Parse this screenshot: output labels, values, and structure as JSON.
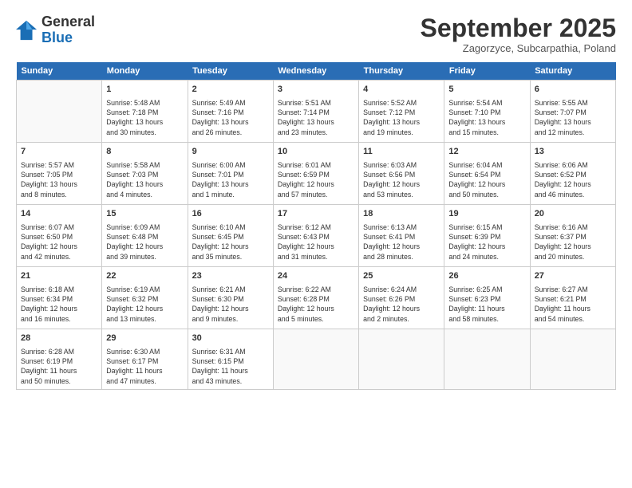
{
  "header": {
    "logo_line1": "General",
    "logo_line2": "Blue",
    "month": "September 2025",
    "location": "Zagorzyce, Subcarpathia, Poland"
  },
  "days_of_week": [
    "Sunday",
    "Monday",
    "Tuesday",
    "Wednesday",
    "Thursday",
    "Friday",
    "Saturday"
  ],
  "weeks": [
    [
      {
        "day": "",
        "text": ""
      },
      {
        "day": "1",
        "text": "Sunrise: 5:48 AM\nSunset: 7:18 PM\nDaylight: 13 hours\nand 30 minutes."
      },
      {
        "day": "2",
        "text": "Sunrise: 5:49 AM\nSunset: 7:16 PM\nDaylight: 13 hours\nand 26 minutes."
      },
      {
        "day": "3",
        "text": "Sunrise: 5:51 AM\nSunset: 7:14 PM\nDaylight: 13 hours\nand 23 minutes."
      },
      {
        "day": "4",
        "text": "Sunrise: 5:52 AM\nSunset: 7:12 PM\nDaylight: 13 hours\nand 19 minutes."
      },
      {
        "day": "5",
        "text": "Sunrise: 5:54 AM\nSunset: 7:10 PM\nDaylight: 13 hours\nand 15 minutes."
      },
      {
        "day": "6",
        "text": "Sunrise: 5:55 AM\nSunset: 7:07 PM\nDaylight: 13 hours\nand 12 minutes."
      }
    ],
    [
      {
        "day": "7",
        "text": "Sunrise: 5:57 AM\nSunset: 7:05 PM\nDaylight: 13 hours\nand 8 minutes."
      },
      {
        "day": "8",
        "text": "Sunrise: 5:58 AM\nSunset: 7:03 PM\nDaylight: 13 hours\nand 4 minutes."
      },
      {
        "day": "9",
        "text": "Sunrise: 6:00 AM\nSunset: 7:01 PM\nDaylight: 13 hours\nand 1 minute."
      },
      {
        "day": "10",
        "text": "Sunrise: 6:01 AM\nSunset: 6:59 PM\nDaylight: 12 hours\nand 57 minutes."
      },
      {
        "day": "11",
        "text": "Sunrise: 6:03 AM\nSunset: 6:56 PM\nDaylight: 12 hours\nand 53 minutes."
      },
      {
        "day": "12",
        "text": "Sunrise: 6:04 AM\nSunset: 6:54 PM\nDaylight: 12 hours\nand 50 minutes."
      },
      {
        "day": "13",
        "text": "Sunrise: 6:06 AM\nSunset: 6:52 PM\nDaylight: 12 hours\nand 46 minutes."
      }
    ],
    [
      {
        "day": "14",
        "text": "Sunrise: 6:07 AM\nSunset: 6:50 PM\nDaylight: 12 hours\nand 42 minutes."
      },
      {
        "day": "15",
        "text": "Sunrise: 6:09 AM\nSunset: 6:48 PM\nDaylight: 12 hours\nand 39 minutes."
      },
      {
        "day": "16",
        "text": "Sunrise: 6:10 AM\nSunset: 6:45 PM\nDaylight: 12 hours\nand 35 minutes."
      },
      {
        "day": "17",
        "text": "Sunrise: 6:12 AM\nSunset: 6:43 PM\nDaylight: 12 hours\nand 31 minutes."
      },
      {
        "day": "18",
        "text": "Sunrise: 6:13 AM\nSunset: 6:41 PM\nDaylight: 12 hours\nand 28 minutes."
      },
      {
        "day": "19",
        "text": "Sunrise: 6:15 AM\nSunset: 6:39 PM\nDaylight: 12 hours\nand 24 minutes."
      },
      {
        "day": "20",
        "text": "Sunrise: 6:16 AM\nSunset: 6:37 PM\nDaylight: 12 hours\nand 20 minutes."
      }
    ],
    [
      {
        "day": "21",
        "text": "Sunrise: 6:18 AM\nSunset: 6:34 PM\nDaylight: 12 hours\nand 16 minutes."
      },
      {
        "day": "22",
        "text": "Sunrise: 6:19 AM\nSunset: 6:32 PM\nDaylight: 12 hours\nand 13 minutes."
      },
      {
        "day": "23",
        "text": "Sunrise: 6:21 AM\nSunset: 6:30 PM\nDaylight: 12 hours\nand 9 minutes."
      },
      {
        "day": "24",
        "text": "Sunrise: 6:22 AM\nSunset: 6:28 PM\nDaylight: 12 hours\nand 5 minutes."
      },
      {
        "day": "25",
        "text": "Sunrise: 6:24 AM\nSunset: 6:26 PM\nDaylight: 12 hours\nand 2 minutes."
      },
      {
        "day": "26",
        "text": "Sunrise: 6:25 AM\nSunset: 6:23 PM\nDaylight: 11 hours\nand 58 minutes."
      },
      {
        "day": "27",
        "text": "Sunrise: 6:27 AM\nSunset: 6:21 PM\nDaylight: 11 hours\nand 54 minutes."
      }
    ],
    [
      {
        "day": "28",
        "text": "Sunrise: 6:28 AM\nSunset: 6:19 PM\nDaylight: 11 hours\nand 50 minutes."
      },
      {
        "day": "29",
        "text": "Sunrise: 6:30 AM\nSunset: 6:17 PM\nDaylight: 11 hours\nand 47 minutes."
      },
      {
        "day": "30",
        "text": "Sunrise: 6:31 AM\nSunset: 6:15 PM\nDaylight: 11 hours\nand 43 minutes."
      },
      {
        "day": "",
        "text": ""
      },
      {
        "day": "",
        "text": ""
      },
      {
        "day": "",
        "text": ""
      },
      {
        "day": "",
        "text": ""
      }
    ]
  ]
}
